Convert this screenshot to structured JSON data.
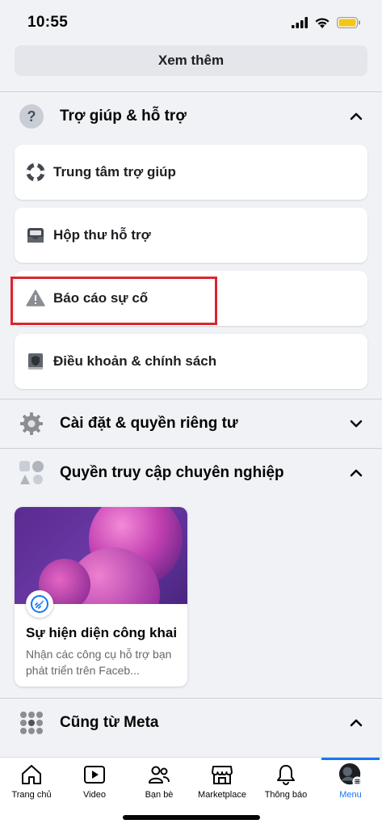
{
  "status_bar": {
    "time": "10:55"
  },
  "see_more": {
    "label": "Xem thêm"
  },
  "help_section": {
    "title": "Trợ giúp & hỗ trợ",
    "icon": "question-icon",
    "items": [
      {
        "label": "Trung tâm trợ giúp",
        "icon": "lifebuoy-icon"
      },
      {
        "label": "Hộp thư hỗ trợ",
        "icon": "inbox-icon"
      },
      {
        "label": "Báo cáo sự cố",
        "icon": "warning-icon"
      },
      {
        "label": "Điều khoản & chính sách",
        "icon": "shield-book-icon"
      }
    ]
  },
  "settings_section": {
    "title": "Cài đặt & quyền riêng tư",
    "icon": "gear-icon"
  },
  "pro_section": {
    "title": "Quyền truy cập chuyên nghiệp",
    "icon": "shapes-icon",
    "card": {
      "title": "Sự hiện diện công khai",
      "description": "Nhận các công cụ hỗ trợ bạn phát triển trên Faceb..."
    }
  },
  "meta_section": {
    "title": "Cũng từ Meta",
    "icon": "grid-icon"
  },
  "tabbar": {
    "tabs": [
      {
        "label": "Trang chủ",
        "icon": "home-icon"
      },
      {
        "label": "Video",
        "icon": "video-icon"
      },
      {
        "label": "Bạn bè",
        "icon": "friends-icon"
      },
      {
        "label": "Marketplace",
        "icon": "marketplace-icon"
      },
      {
        "label": "Thông báo",
        "icon": "bell-icon"
      },
      {
        "label": "Menu",
        "icon": "menu-avatar-icon"
      }
    ],
    "active_tab": "Menu"
  },
  "colors": {
    "accent": "#1877f2",
    "highlight": "#d9262e",
    "background": "#f0f2f5"
  }
}
